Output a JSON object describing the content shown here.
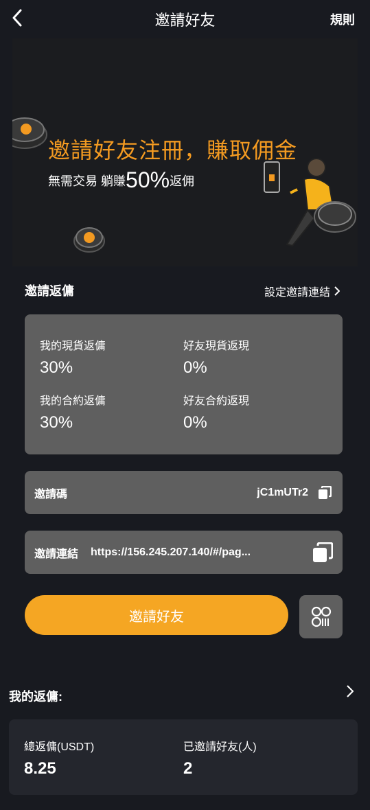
{
  "header": {
    "title": "邀請好友",
    "rules_label": "規則"
  },
  "banner": {
    "headline": "邀請好友注冊，賺取佣金",
    "sub_prefix": "無需交易 躺賺",
    "sub_percent": "50%",
    "sub_suffix": "返佣"
  },
  "rebate_section": {
    "title": "邀請返傭",
    "set_link_label": "設定邀請連結"
  },
  "rates": [
    {
      "label": "我的現貨返傭",
      "value": "30%"
    },
    {
      "label": "好友現貨返現",
      "value": "0%"
    },
    {
      "label": "我的合約返傭",
      "value": "30%"
    },
    {
      "label": "好友合約返現",
      "value": "0%"
    }
  ],
  "invite_code": {
    "label": "邀請碼",
    "value": "jC1mUTr2"
  },
  "invite_link": {
    "label": "邀請連結",
    "value": "https://156.245.207.140/#/pag..."
  },
  "invite_button_label": "邀請好友",
  "my_rebate": {
    "title": "我的返傭:",
    "total_label": "總返傭(USDT)",
    "total_value": "8.25",
    "invited_label": "已邀請好友(人)",
    "invited_value": "2"
  },
  "colors": {
    "accent": "#f5a623",
    "banner_headline": "#f39a21",
    "card_bg": "#5f5f5f",
    "page_bg": "#181a20"
  }
}
